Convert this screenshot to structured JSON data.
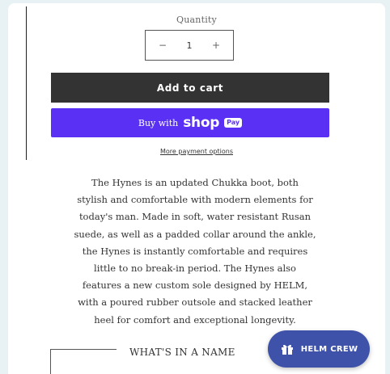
{
  "product_form": {
    "quantity_label": "Quantity",
    "quantity": {
      "decrement_symbol": "−",
      "value": "1",
      "increment_symbol": "+"
    },
    "add_to_cart_label": "Add to cart",
    "shop_pay": {
      "prefix": "Buy with",
      "brand": "shop",
      "badge": "Pay"
    },
    "more_payment_options_label": "More payment options"
  },
  "description": {
    "lines": [
      "The Hynes is an updated Chukka boot, both",
      "stylish and comfortable with modern elements for",
      "today's man. Made in soft, water resistant Rusan",
      "suede, as well as a padded collar around the ankle,",
      "the Hynes is instantly comfortable and requires",
      "little to no break-in period. The Hynes also",
      "features a new custom sole designed by HELM,",
      "with a poured rubber outsole and stacked leather",
      "heel for comfort and exceptional longevity."
    ]
  },
  "section": {
    "title": "WHAT'S IN A NAME"
  },
  "rewards_launcher": {
    "label": "HELM CREW",
    "icon": "gift-icon"
  },
  "colors": {
    "page_bg": "#e8f2f4",
    "add_to_cart_bg": "#333333",
    "shop_pay_bg": "#5a31f4",
    "rewards_bg": "#3d52a8"
  }
}
